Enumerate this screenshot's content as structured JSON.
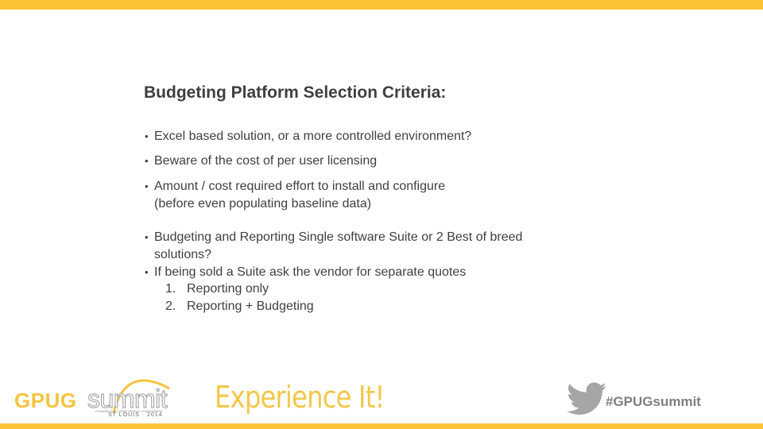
{
  "title": "Budgeting Platform Selection Criteria:",
  "bullets": [
    {
      "text": "Excel based solution, or a more controlled environment?"
    },
    {
      "text": "Beware of the cost of per user licensing"
    },
    {
      "line1": "Amount / cost required effort to install and configure",
      "line2": "(before even populating baseline data)"
    },
    {
      "line1": "Budgeting and Reporting Single software Suite or 2 Best of breed",
      "line2": "solutions?"
    },
    {
      "text": "If being sold a Suite ask the vendor for separate quotes"
    }
  ],
  "numbered": [
    {
      "n": "1.",
      "text": "Reporting only"
    },
    {
      "n": "2.",
      "text": "Reporting + Budgeting"
    }
  ],
  "bullet_char": "•",
  "footer": {
    "logo_gpug": "GPUG",
    "logo_summit": "summit",
    "logo_tagline": "DYNAMICS GP USER GROUP CONFERENCE",
    "logo_location": "ST LOUIS · 2014",
    "slogan": "Experience It!",
    "hashtag": "#GPUGsummit",
    "twitter_icon": "twitter-bird-icon"
  },
  "colors": {
    "accent": "#fec236",
    "text": "#404040",
    "hashtag": "#7f7f7f"
  }
}
